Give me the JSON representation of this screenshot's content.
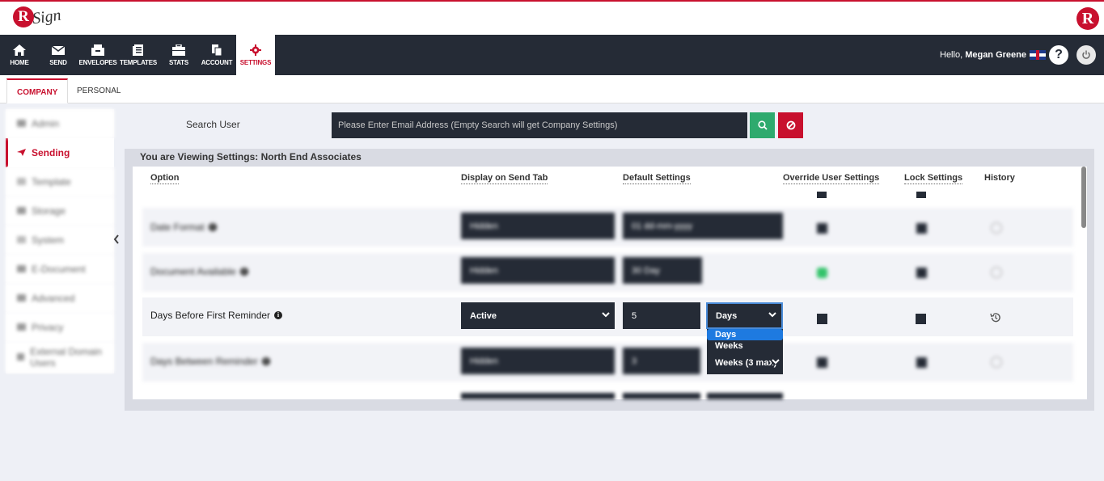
{
  "app": {
    "logo_text": "Sign",
    "logo_letter": "R"
  },
  "nav": {
    "items": [
      {
        "label": "HOME",
        "icon": "home-icon"
      },
      {
        "label": "SEND",
        "icon": "envelope-icon"
      },
      {
        "label": "ENVELOPES",
        "icon": "inbox-icon"
      },
      {
        "label": "TEMPLATES",
        "icon": "template-icon"
      },
      {
        "label": "STATS",
        "icon": "briefcase-icon"
      },
      {
        "label": "ACCOUNT",
        "icon": "account-icon"
      },
      {
        "label": "SETTINGS",
        "icon": "gear-icon",
        "active": true
      }
    ],
    "hello_prefix": "Hello,",
    "user_name": "Megan Greene",
    "help_label": "?"
  },
  "subtabs": {
    "company": "COMPANY",
    "personal": "PERSONAL"
  },
  "sidebar": {
    "items": [
      {
        "label": "Admin",
        "blurred": true
      },
      {
        "label": "Sending",
        "active": true
      },
      {
        "label": "Template",
        "blurred": true
      },
      {
        "label": "Storage",
        "blurred": true
      },
      {
        "label": "System",
        "blurred": true
      },
      {
        "label": "E-Document",
        "blurred": true
      },
      {
        "label": "Advanced",
        "blurred": true
      },
      {
        "label": "Privacy",
        "blurred": true
      },
      {
        "label": "External Domain Users",
        "blurred": true
      }
    ]
  },
  "search": {
    "label": "Search User",
    "placeholder": "Please Enter Email Address (Empty Search will get Company Settings)"
  },
  "viewing": {
    "text": "You are Viewing Settings: North End Associates"
  },
  "table": {
    "headers": {
      "option": "Option",
      "display": "Display on Send Tab",
      "default": "Default Settings",
      "override": "Override User Settings",
      "lock": "Lock Settings",
      "history": "History"
    },
    "rows": [
      {
        "label": "Date Format",
        "display": "Hidden",
        "default": "01 dd-mm-yyyy",
        "blurred": true
      },
      {
        "label": "Document Available",
        "display": "Hidden",
        "default": "30 Day",
        "blurred": true
      },
      {
        "label": "Days Before First Reminder",
        "display": "Active",
        "default": "5",
        "unit": "Days"
      },
      {
        "label": "Days Between Reminder",
        "display": "Hidden",
        "default": "3",
        "blurred": true
      }
    ],
    "unit_options": [
      "Days",
      "Weeks",
      "Weeks (3 max)"
    ]
  },
  "colors": {
    "accent": "#c8102e",
    "dark": "#252b36",
    "search": "#2eaa6e",
    "selected": "#1e7ae0"
  }
}
